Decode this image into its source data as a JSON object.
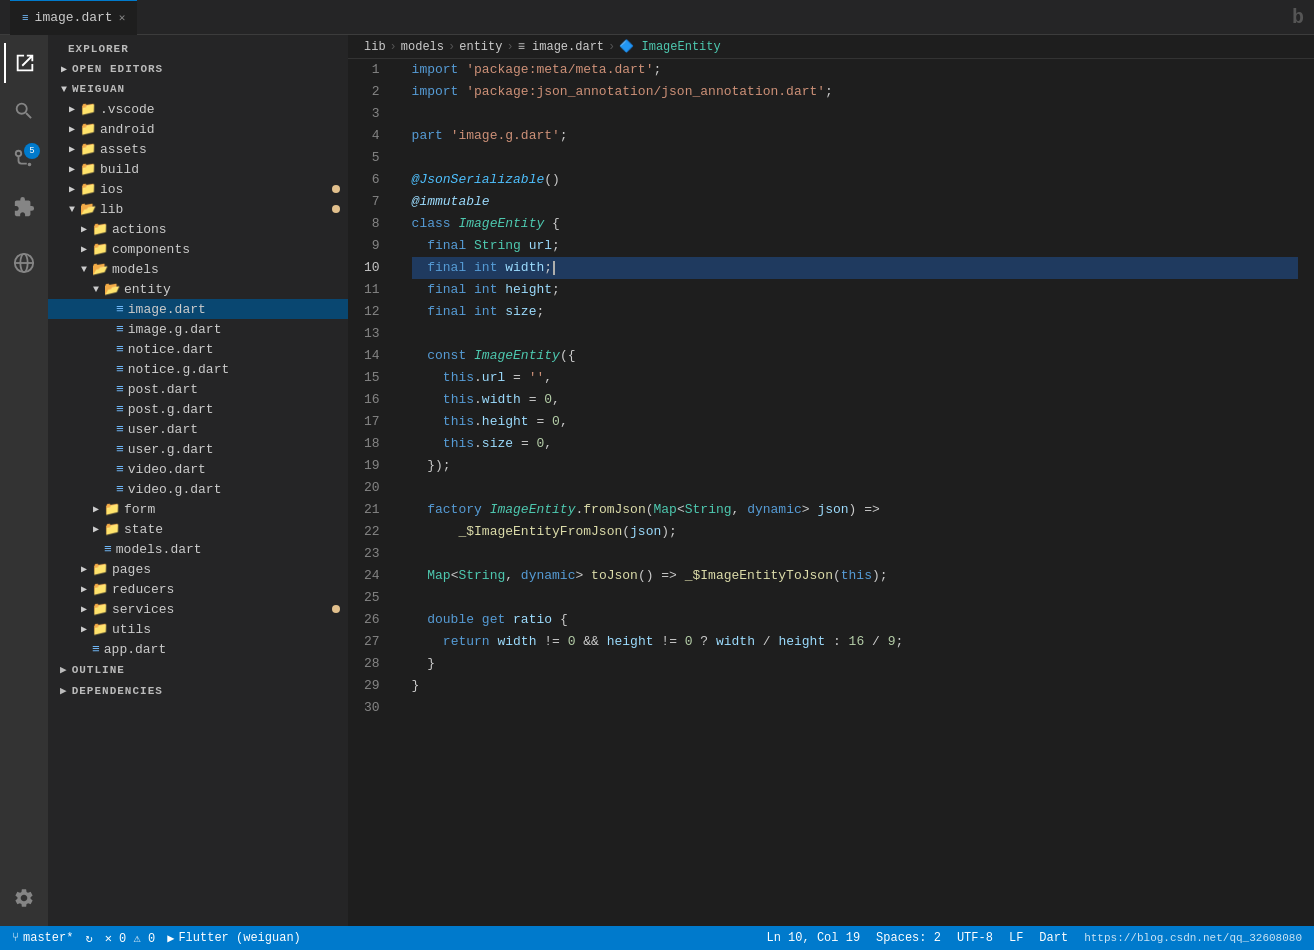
{
  "titlebar": {
    "tab_name": "image.dart",
    "tab_icon": "≡",
    "corner_text": "b"
  },
  "breadcrumb": {
    "parts": [
      "lib",
      "models",
      "entity",
      "≡ image.dart",
      "🔷 ImageEntity"
    ]
  },
  "activity_bar": {
    "icons": [
      {
        "name": "explorer-icon",
        "symbol": "⬜",
        "active": true
      },
      {
        "name": "search-icon",
        "symbol": "🔍",
        "active": false
      },
      {
        "name": "source-control-icon",
        "symbol": "⑂",
        "active": false,
        "badge": "5"
      },
      {
        "name": "extensions-icon",
        "symbol": "⊞",
        "active": false
      },
      {
        "name": "remote-icon",
        "symbol": "⊙",
        "active": false
      },
      {
        "name": "settings-icon",
        "symbol": "⚙",
        "active": false
      }
    ]
  },
  "sidebar": {
    "title": "EXPLORER",
    "sections": [
      {
        "label": "OPEN EDITORS",
        "collapsed": true,
        "indent": 0
      },
      {
        "label": "WEIGUAN",
        "collapsed": false,
        "indent": 0
      },
      {
        "label": ".vscode",
        "collapsed": true,
        "indent": 1,
        "type": "folder"
      },
      {
        "label": "android",
        "collapsed": true,
        "indent": 1,
        "type": "folder"
      },
      {
        "label": "assets",
        "collapsed": true,
        "indent": 1,
        "type": "folder"
      },
      {
        "label": "build",
        "collapsed": true,
        "indent": 1,
        "type": "folder"
      },
      {
        "label": "ios",
        "collapsed": true,
        "indent": 1,
        "type": "folder",
        "dot": true
      },
      {
        "label": "lib",
        "collapsed": false,
        "indent": 1,
        "type": "folder",
        "dot": true
      },
      {
        "label": "actions",
        "collapsed": true,
        "indent": 2,
        "type": "folder"
      },
      {
        "label": "components",
        "collapsed": true,
        "indent": 2,
        "type": "folder"
      },
      {
        "label": "models",
        "collapsed": false,
        "indent": 2,
        "type": "folder"
      },
      {
        "label": "entity",
        "collapsed": false,
        "indent": 3,
        "type": "folder"
      },
      {
        "label": "image.dart",
        "collapsed": false,
        "indent": 4,
        "type": "file",
        "selected": true
      },
      {
        "label": "image.g.dart",
        "collapsed": false,
        "indent": 4,
        "type": "file"
      },
      {
        "label": "notice.dart",
        "collapsed": false,
        "indent": 4,
        "type": "file"
      },
      {
        "label": "notice.g.dart",
        "collapsed": false,
        "indent": 4,
        "type": "file"
      },
      {
        "label": "post.dart",
        "collapsed": false,
        "indent": 4,
        "type": "file"
      },
      {
        "label": "post.g.dart",
        "collapsed": false,
        "indent": 4,
        "type": "file"
      },
      {
        "label": "user.dart",
        "collapsed": false,
        "indent": 4,
        "type": "file"
      },
      {
        "label": "user.g.dart",
        "collapsed": false,
        "indent": 4,
        "type": "file"
      },
      {
        "label": "video.dart",
        "collapsed": false,
        "indent": 4,
        "type": "file"
      },
      {
        "label": "video.g.dart",
        "collapsed": false,
        "indent": 4,
        "type": "file"
      },
      {
        "label": "form",
        "collapsed": true,
        "indent": 3,
        "type": "folder"
      },
      {
        "label": "state",
        "collapsed": true,
        "indent": 3,
        "type": "folder"
      },
      {
        "label": "models.dart",
        "collapsed": false,
        "indent": 3,
        "type": "file"
      },
      {
        "label": "pages",
        "collapsed": true,
        "indent": 2,
        "type": "folder"
      },
      {
        "label": "reducers",
        "collapsed": true,
        "indent": 2,
        "type": "folder"
      },
      {
        "label": "services",
        "collapsed": true,
        "indent": 2,
        "type": "folder",
        "dot": true
      },
      {
        "label": "utils",
        "collapsed": true,
        "indent": 2,
        "type": "folder"
      },
      {
        "label": "app.dart",
        "collapsed": false,
        "indent": 2,
        "type": "file"
      }
    ],
    "outline": "OUTLINE",
    "dependencies": "DEPENDENCIES"
  },
  "code": {
    "lines": [
      {
        "num": 1,
        "tokens": [
          {
            "t": "kw",
            "v": "import"
          },
          {
            "t": "plain",
            "v": " "
          },
          {
            "t": "string",
            "v": "'package:meta/meta.dart'"
          },
          {
            "t": "plain",
            "v": ";"
          }
        ]
      },
      {
        "num": 2,
        "tokens": [
          {
            "t": "kw",
            "v": "import"
          },
          {
            "t": "plain",
            "v": " "
          },
          {
            "t": "string",
            "v": "'package:json_annotation/json_annotation.dart'"
          },
          {
            "t": "plain",
            "v": ";"
          }
        ]
      },
      {
        "num": 3,
        "tokens": []
      },
      {
        "num": 4,
        "tokens": [
          {
            "t": "kw",
            "v": "part"
          },
          {
            "t": "plain",
            "v": " "
          },
          {
            "t": "string",
            "v": "'image.g.dart'"
          },
          {
            "t": "plain",
            "v": ";"
          }
        ]
      },
      {
        "num": 5,
        "tokens": []
      },
      {
        "num": 6,
        "tokens": [
          {
            "t": "annotation",
            "v": "@JsonSerializable"
          },
          {
            "t": "plain",
            "v": "()"
          }
        ]
      },
      {
        "num": 7,
        "tokens": [
          {
            "t": "immutable",
            "v": "@immutable"
          }
        ]
      },
      {
        "num": 8,
        "tokens": [
          {
            "t": "kw",
            "v": "class"
          },
          {
            "t": "plain",
            "v": " "
          },
          {
            "t": "class-name",
            "v": "ImageEntity"
          },
          {
            "t": "plain",
            "v": " {"
          }
        ]
      },
      {
        "num": 9,
        "tokens": [
          {
            "t": "plain",
            "v": "  "
          },
          {
            "t": "kw",
            "v": "final"
          },
          {
            "t": "plain",
            "v": " "
          },
          {
            "t": "type",
            "v": "String"
          },
          {
            "t": "plain",
            "v": " "
          },
          {
            "t": "var",
            "v": "url"
          },
          {
            "t": "plain",
            "v": ";"
          }
        ]
      },
      {
        "num": 10,
        "tokens": [
          {
            "t": "plain",
            "v": "  "
          },
          {
            "t": "kw",
            "v": "final"
          },
          {
            "t": "plain",
            "v": " "
          },
          {
            "t": "kw",
            "v": "int"
          },
          {
            "t": "plain",
            "v": " "
          },
          {
            "t": "var",
            "v": "width"
          },
          {
            "t": "plain",
            "v": ";"
          }
        ],
        "cursor": true
      },
      {
        "num": 11,
        "tokens": [
          {
            "t": "plain",
            "v": "  "
          },
          {
            "t": "kw",
            "v": "final"
          },
          {
            "t": "plain",
            "v": " "
          },
          {
            "t": "kw",
            "v": "int"
          },
          {
            "t": "plain",
            "v": " "
          },
          {
            "t": "var",
            "v": "height"
          },
          {
            "t": "plain",
            "v": ";"
          }
        ]
      },
      {
        "num": 12,
        "tokens": [
          {
            "t": "plain",
            "v": "  "
          },
          {
            "t": "kw",
            "v": "final"
          },
          {
            "t": "plain",
            "v": " "
          },
          {
            "t": "kw",
            "v": "int"
          },
          {
            "t": "plain",
            "v": " "
          },
          {
            "t": "var",
            "v": "size"
          },
          {
            "t": "plain",
            "v": ";"
          }
        ]
      },
      {
        "num": 13,
        "tokens": []
      },
      {
        "num": 14,
        "tokens": [
          {
            "t": "plain",
            "v": "  "
          },
          {
            "t": "kw",
            "v": "const"
          },
          {
            "t": "plain",
            "v": " "
          },
          {
            "t": "class-name",
            "v": "ImageEntity"
          },
          {
            "t": "plain",
            "v": "({"
          }
        ]
      },
      {
        "num": 15,
        "tokens": [
          {
            "t": "plain",
            "v": "    "
          },
          {
            "t": "kw",
            "v": "this"
          },
          {
            "t": "plain",
            "v": "."
          },
          {
            "t": "var",
            "v": "url"
          },
          {
            "t": "plain",
            "v": " = "
          },
          {
            "t": "string",
            "v": "''"
          },
          {
            "t": "plain",
            "v": ","
          }
        ]
      },
      {
        "num": 16,
        "tokens": [
          {
            "t": "plain",
            "v": "    "
          },
          {
            "t": "kw",
            "v": "this"
          },
          {
            "t": "plain",
            "v": "."
          },
          {
            "t": "var",
            "v": "width"
          },
          {
            "t": "plain",
            "v": " = "
          },
          {
            "t": "number",
            "v": "0"
          },
          {
            "t": "plain",
            "v": ","
          }
        ]
      },
      {
        "num": 17,
        "tokens": [
          {
            "t": "plain",
            "v": "    "
          },
          {
            "t": "kw",
            "v": "this"
          },
          {
            "t": "plain",
            "v": "."
          },
          {
            "t": "var",
            "v": "height"
          },
          {
            "t": "plain",
            "v": " = "
          },
          {
            "t": "number",
            "v": "0"
          },
          {
            "t": "plain",
            "v": ","
          }
        ]
      },
      {
        "num": 18,
        "tokens": [
          {
            "t": "plain",
            "v": "    "
          },
          {
            "t": "kw",
            "v": "this"
          },
          {
            "t": "plain",
            "v": "."
          },
          {
            "t": "var",
            "v": "size"
          },
          {
            "t": "plain",
            "v": " = "
          },
          {
            "t": "number",
            "v": "0"
          },
          {
            "t": "plain",
            "v": ","
          }
        ]
      },
      {
        "num": 19,
        "tokens": [
          {
            "t": "plain",
            "v": "  "
          },
          {
            "t": "plain",
            "v": "});"
          }
        ]
      },
      {
        "num": 20,
        "tokens": []
      },
      {
        "num": 21,
        "tokens": [
          {
            "t": "plain",
            "v": "  "
          },
          {
            "t": "kw",
            "v": "factory"
          },
          {
            "t": "plain",
            "v": " "
          },
          {
            "t": "class-name",
            "v": "ImageEntity"
          },
          {
            "t": "plain",
            "v": "."
          },
          {
            "t": "fn",
            "v": "fromJson"
          },
          {
            "t": "plain",
            "v": "("
          },
          {
            "t": "type",
            "v": "Map"
          },
          {
            "t": "plain",
            "v": "<"
          },
          {
            "t": "type",
            "v": "String"
          },
          {
            "t": "plain",
            "v": ", "
          },
          {
            "t": "kw",
            "v": "dynamic"
          },
          {
            "t": "plain",
            "v": "> "
          },
          {
            "t": "var",
            "v": "json"
          },
          {
            "t": "plain",
            "v": ") =>"
          }
        ]
      },
      {
        "num": 22,
        "tokens": [
          {
            "t": "plain",
            "v": "      "
          },
          {
            "t": "fn",
            "v": "_$ImageEntityFromJson"
          },
          {
            "t": "plain",
            "v": "("
          },
          {
            "t": "var",
            "v": "json"
          },
          {
            "t": "plain",
            "v": ");"
          }
        ]
      },
      {
        "num": 23,
        "tokens": []
      },
      {
        "num": 24,
        "tokens": [
          {
            "t": "plain",
            "v": "  "
          },
          {
            "t": "type",
            "v": "Map"
          },
          {
            "t": "plain",
            "v": "<"
          },
          {
            "t": "type",
            "v": "String"
          },
          {
            "t": "plain",
            "v": ", "
          },
          {
            "t": "kw",
            "v": "dynamic"
          },
          {
            "t": "plain",
            "v": "> "
          },
          {
            "t": "fn",
            "v": "toJson"
          },
          {
            "t": "plain",
            "v": "() => "
          },
          {
            "t": "fn",
            "v": "_$ImageEntityToJson"
          },
          {
            "t": "plain",
            "v": "("
          },
          {
            "t": "kw",
            "v": "this"
          },
          {
            "t": "plain",
            "v": ");"
          }
        ]
      },
      {
        "num": 25,
        "tokens": []
      },
      {
        "num": 26,
        "tokens": [
          {
            "t": "plain",
            "v": "  "
          },
          {
            "t": "kw",
            "v": "double"
          },
          {
            "t": "plain",
            "v": " "
          },
          {
            "t": "kw",
            "v": "get"
          },
          {
            "t": "plain",
            "v": " "
          },
          {
            "t": "var",
            "v": "ratio"
          },
          {
            "t": "plain",
            "v": " {"
          }
        ]
      },
      {
        "num": 27,
        "tokens": [
          {
            "t": "plain",
            "v": "    "
          },
          {
            "t": "kw",
            "v": "return"
          },
          {
            "t": "plain",
            "v": " "
          },
          {
            "t": "var",
            "v": "width"
          },
          {
            "t": "plain",
            "v": " != "
          },
          {
            "t": "number",
            "v": "0"
          },
          {
            "t": "plain",
            "v": " && "
          },
          {
            "t": "var",
            "v": "height"
          },
          {
            "t": "plain",
            "v": " != "
          },
          {
            "t": "number",
            "v": "0"
          },
          {
            "t": "plain",
            "v": " ? "
          },
          {
            "t": "var",
            "v": "width"
          },
          {
            "t": "plain",
            "v": " / "
          },
          {
            "t": "var",
            "v": "height"
          },
          {
            "t": "plain",
            "v": " : "
          },
          {
            "t": "number",
            "v": "16"
          },
          {
            "t": "plain",
            "v": " / "
          },
          {
            "t": "number",
            "v": "9"
          },
          {
            "t": "plain",
            "v": ";"
          }
        ]
      },
      {
        "num": 28,
        "tokens": [
          {
            "t": "plain",
            "v": "  }"
          }
        ]
      },
      {
        "num": 29,
        "tokens": [
          {
            "t": "plain",
            "v": "}"
          }
        ]
      },
      {
        "num": 30,
        "tokens": []
      }
    ]
  },
  "statusbar": {
    "git_branch": "master*",
    "sync_icon": "↻",
    "errors": "0",
    "warnings": "0",
    "position": "Ln 10, Col 19",
    "spaces": "Spaces: 2",
    "encoding": "UTF-8",
    "eol": "LF",
    "language": "Dart",
    "flutter": "Flutter (weiguan)",
    "url": "https://blog.csdn.net/qq_32608080"
  }
}
